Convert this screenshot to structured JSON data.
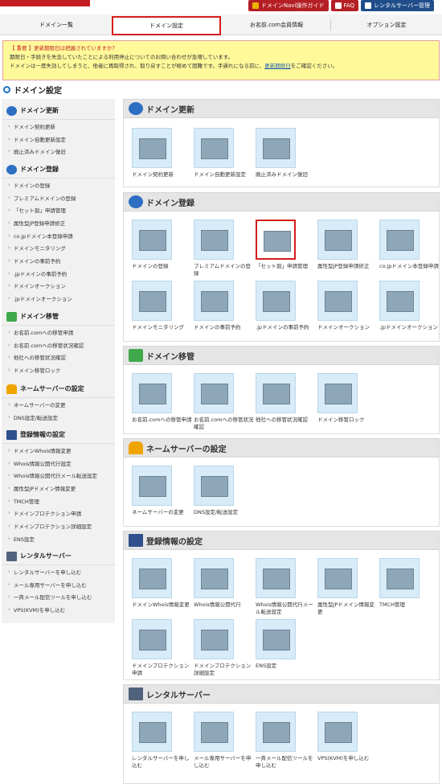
{
  "toplinks": {
    "guide": "ドメインNavi操作ガイド",
    "faq": "FAQ",
    "rental": "レンタルサーバー管理"
  },
  "nav": {
    "tabs": [
      "ドメイン一覧",
      "ドメイン設定",
      "お名前.com会員情報",
      "オプション設定"
    ]
  },
  "notice": {
    "title": "【 重要 】更新期限日は把握されていますか？",
    "line1": "期限日・手続きを失念していたことによる利用停止についてのお問い合わせが急増しています。",
    "line2": "ドメインは一度失効してしまうと、他者に再取得され、取り戻すことが極めて困難です。手遅れになる前に、",
    "link": "更新期限日",
    "line2b": "をご確認ください。"
  },
  "page_title": "ドメイン設定",
  "sidebar": {
    "renew": {
      "title": "ドメイン更新",
      "items": [
        "ドメイン契約更新",
        "ドメイン自動更新設定",
        "廃止済みドメイン復旧"
      ]
    },
    "register": {
      "title": "ドメイン登録",
      "items": [
        "ドメインの登録",
        "プレミアムドメインの登録",
        "「セット割」申請管理",
        "属性型JP登録申請修正",
        "co.jpドメイン本登録申請",
        "ドメインモニタリング",
        "ドメインの事前予約",
        ".jpドメインの事前予約",
        "ドメインオークション",
        ".jpドメインオークション"
      ]
    },
    "transfer": {
      "title": "ドメイン移管",
      "items": [
        "お名前.comへの移管申請",
        "お名前.comへの移管状況確認",
        "他社への移管状況確認",
        "ドメイン移管ロック"
      ]
    },
    "nameserver": {
      "title": "ネームサーバーの設定",
      "items": [
        "ネームサーバーの変更",
        "DNS設定/転送設定"
      ]
    },
    "whois": {
      "title": "登録情報の設定",
      "items": [
        "ドメインWhois情報変更",
        "Whois情報公開代行設定",
        "Whois情報公開代行メール転送設定",
        "属性型JPドメイン情報変更",
        "TMCH管理",
        "ドメインプロテクション申請",
        "ドメインプロテクション詳細設定",
        "ENS設定"
      ]
    },
    "server": {
      "title": "レンタルサーバー",
      "items": [
        "レンタルサーバーを申し込む",
        "メール専用サーバーを申し込む",
        "一斉メール配信ツールを申し込む",
        "VPS(KVM)を申し込む"
      ]
    }
  },
  "main": {
    "renew": {
      "title": "ドメイン更新",
      "items": [
        "ドメイン契約更新",
        "ドメイン自動更新設定",
        "廃止済みドメイン復旧"
      ]
    },
    "register": {
      "title": "ドメイン登録",
      "items": [
        "ドメインの登録",
        "プレミアムドメインの登録",
        "「セット割」申請管理",
        "属性型JP登録申請修正",
        "co.jpドメイン本登録申請",
        "ドメインモニタリング",
        "ドメインの事前予約",
        ".jpドメインの事前予約",
        "ドメインオークション",
        ".jpドメインオークション"
      ]
    },
    "transfer": {
      "title": "ドメイン移管",
      "items": [
        "お名前.comへの移管申請",
        "お名前.comへの移管状況確認",
        "他社への移管状況確認",
        "ドメイン移管ロック"
      ]
    },
    "nameserver": {
      "title": "ネームサーバーの設定",
      "items": [
        "ネームサーバーの変更",
        "DNS設定/転送設定"
      ]
    },
    "whois": {
      "title": "登録情報の設定",
      "items": [
        "ドメインWhois情報変更",
        "Whois情報公開代行",
        "Whois情報公開代行メール転送設定",
        "属性型JPドメイン情報変更",
        "TMCH管理",
        "ドメインプロテクション申請",
        "ドメインプロテクション詳細設定",
        "ENS設定"
      ]
    },
    "server": {
      "title": "レンタルサーバー",
      "items": [
        "レンタルサーバーを申し込む",
        "メール専用サーバーを申し込む",
        "一斉メール配信ツールを申し込む",
        "VPS(KVM)を申し込む"
      ]
    }
  },
  "selected_item": "「セット割」申請管理"
}
